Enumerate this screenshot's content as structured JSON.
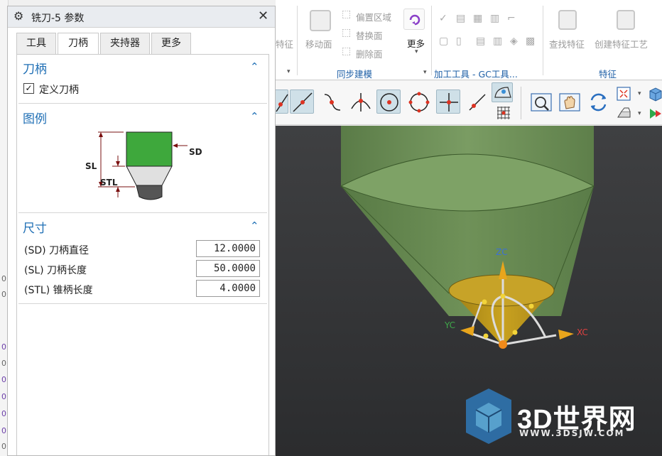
{
  "left_strip": {
    "marks": [
      "0",
      "0",
      "0",
      "0",
      "0",
      "0",
      "0",
      "0",
      "0"
    ]
  },
  "ribbon": {
    "items": {
      "move_face": "移动面",
      "offset_region": "偏置区域",
      "replace_face": "替换面",
      "delete_face": "删除面",
      "more": "更多",
      "find_feature": "查找特征",
      "create_feature_process": "创建特征工艺",
      "feature_partial": "特征"
    },
    "groups": {
      "sync_modeling": "同步建模",
      "machining_tools": "加工工具 - GC工具...",
      "feature": "特征"
    }
  },
  "dialog": {
    "title": "铣刀-5 参数",
    "close": "✕",
    "tabs": [
      "工具",
      "刀柄",
      "夹持器",
      "更多"
    ],
    "active_tab": "刀柄",
    "sections": {
      "shank": {
        "title": "刀柄",
        "checkbox_label": "定义刀柄",
        "checked": true
      },
      "legend": {
        "title": "图例",
        "labels": {
          "sd": "SD",
          "sl": "SL",
          "stl": "STL"
        }
      },
      "dimensions": {
        "title": "尺寸",
        "rows": [
          {
            "label": "(SD) 刀柄直径",
            "value": "12.0000"
          },
          {
            "label": "(SL) 刀柄长度",
            "value": "50.0000"
          },
          {
            "label": "(STL) 锥柄长度",
            "value": "4.0000"
          }
        ]
      }
    }
  },
  "viewport": {
    "axes": {
      "z": "ZC",
      "x": "XC",
      "y": "YC"
    },
    "colors": {
      "tool_green": "#6a8d55",
      "cone_yellow": "#c9a21f",
      "bg_top": "#3f4042",
      "axis_z": "#3b6fd8",
      "axis_x": "#e04040",
      "axis_y": "#3fa84a"
    }
  },
  "watermark": {
    "brand": "3D世界网",
    "url": "WWW.3DSJW.COM"
  }
}
